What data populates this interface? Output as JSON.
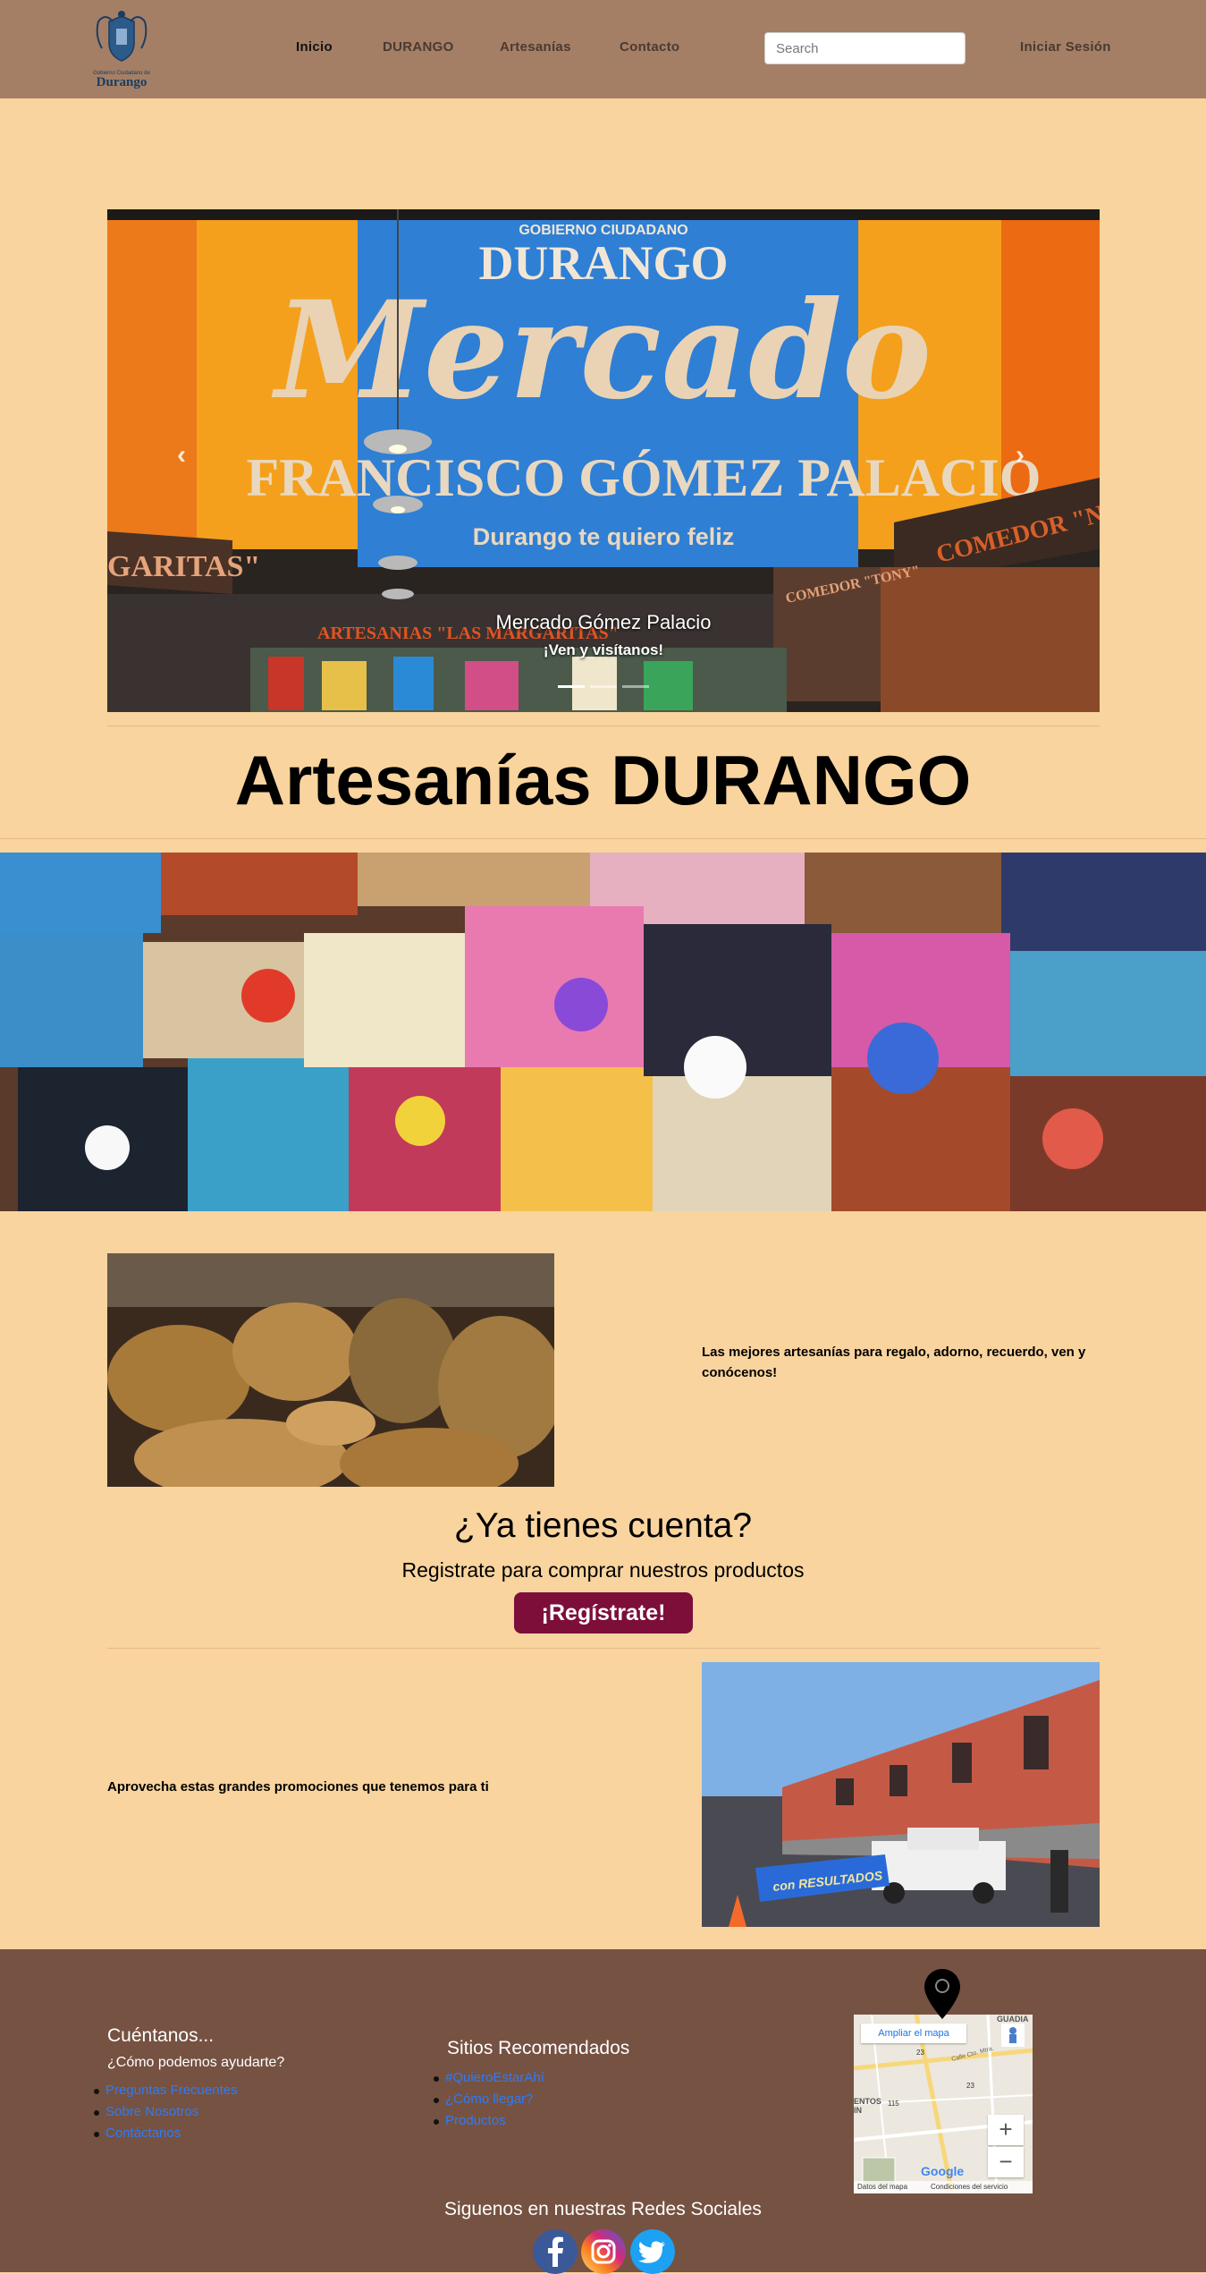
{
  "nav": {
    "logo_text": "Durango",
    "logo_small": "Gobierno Ciudadano de",
    "links": [
      "Inicio",
      "DURANGO",
      "Artesanías",
      "Contacto"
    ],
    "search_placeholder": "Search",
    "login": "Iniciar Sesión"
  },
  "carousel": {
    "caption_title": "Mercado Gómez Palacio",
    "caption_sub": "¡Ven y visítanos!",
    "sign_top": "GOBIERNO CIUDADANO",
    "sign_brand": "DURANGO",
    "sign_script": "Mercado",
    "sign_name": "FRANCISCO GÓMEZ PALACIO",
    "sign_motto": "Durango te quiero feliz",
    "sign_left": "GARITAS\"",
    "sign_right": "COMEDOR \"NACHITA\"",
    "sign_artesanias": "ARTESANIAS \"LAS MARGARITAS\"",
    "sign_small": "COMEDOR \"TONY\""
  },
  "main_title": "Artesanías DURANGO",
  "promo_text": "Las mejores artesanías para regalo, adorno, recuerdo, ven y conócenos!",
  "account": {
    "title": "¿Ya tienes cuenta?",
    "subtitle": "Registrate para comprar nuestros productos",
    "button": "¡Regístrate!"
  },
  "promo2_text": "Aprovecha estas grandes promociones que tenemos para ti",
  "street_banner": "con RESULTADOS",
  "footer": {
    "col1_title": "Cuéntanos...",
    "col1_sub": "¿Cómo podemos ayudarte?",
    "col1_links": [
      "Preguntas Frecuentes",
      "Sobre Nosotros",
      "Contáctanos"
    ],
    "col2_title": "Sitios Recomendados",
    "col2_links": [
      "#QuieroEstarAhí",
      "¿Cómo llegar?",
      "Productos"
    ],
    "map_button": "Ampliar el mapa",
    "map_labels": [
      "GUADIA",
      "ENTOS",
      "IN",
      "Calle Cto. Mtra.",
      "23",
      "115",
      "23"
    ],
    "map_footer_left": "Datos del mapa",
    "map_footer_right": "Condiciones del servicio",
    "map_brand": "Google",
    "zoom_in": "+",
    "zoom_out": "−",
    "social_title": "Siguenos en nuestras Redes Sociales"
  },
  "colors": {
    "page_bg": "#f9d49e",
    "navbar": "#a47f66",
    "footer": "#765242",
    "button": "#7d0e3a",
    "link": "#2f7bf5"
  }
}
